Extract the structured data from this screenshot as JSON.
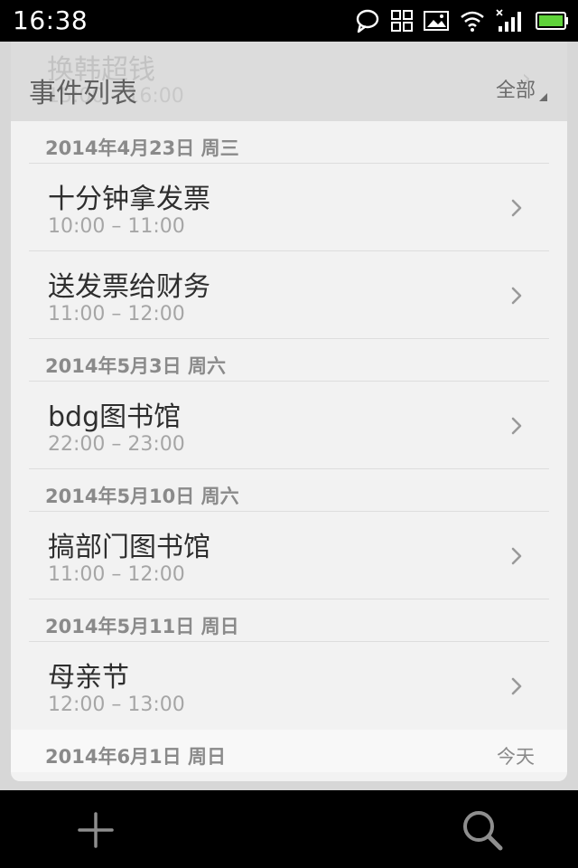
{
  "status_bar": {
    "time": "16:38",
    "icons": [
      "message-icon",
      "grid-icon",
      "image-icon",
      "wifi-icon",
      "signal-icon",
      "battery-icon"
    ]
  },
  "header": {
    "title": "事件列表",
    "filter_label": "全部",
    "ghost_event_title": "换韩超钱",
    "ghost_event_time": "15:00 – 16:00"
  },
  "groups": [
    {
      "date": "2014年4月23日 周三",
      "events": [
        {
          "title": "十分钟拿发票",
          "time": "10:00 – 11:00"
        },
        {
          "title": "送发票给财务",
          "time": "11:00 – 12:00"
        }
      ]
    },
    {
      "date": "2014年5月3日 周六",
      "events": [
        {
          "title": "bdg图书馆",
          "time": "22:00 – 23:00"
        }
      ]
    },
    {
      "date": "2014年5月10日 周六",
      "events": [
        {
          "title": "搞部门图书馆",
          "time": "11:00 – 12:00"
        }
      ]
    },
    {
      "date": "2014年5月11日 周日",
      "events": [
        {
          "title": "母亲节",
          "time": "12:00 – 13:00"
        }
      ]
    }
  ],
  "last_group": {
    "date": "2014年6月1日 周日",
    "today_label": "今天"
  },
  "bottom_bar": {
    "add_icon": "plus-icon",
    "search_icon": "search-icon"
  },
  "colors": {
    "card_bg": "#f2f2f2",
    "header_bg": "#dcdcdc",
    "title_text": "#2e2e2e",
    "secondary_text": "#a6a6a6"
  }
}
